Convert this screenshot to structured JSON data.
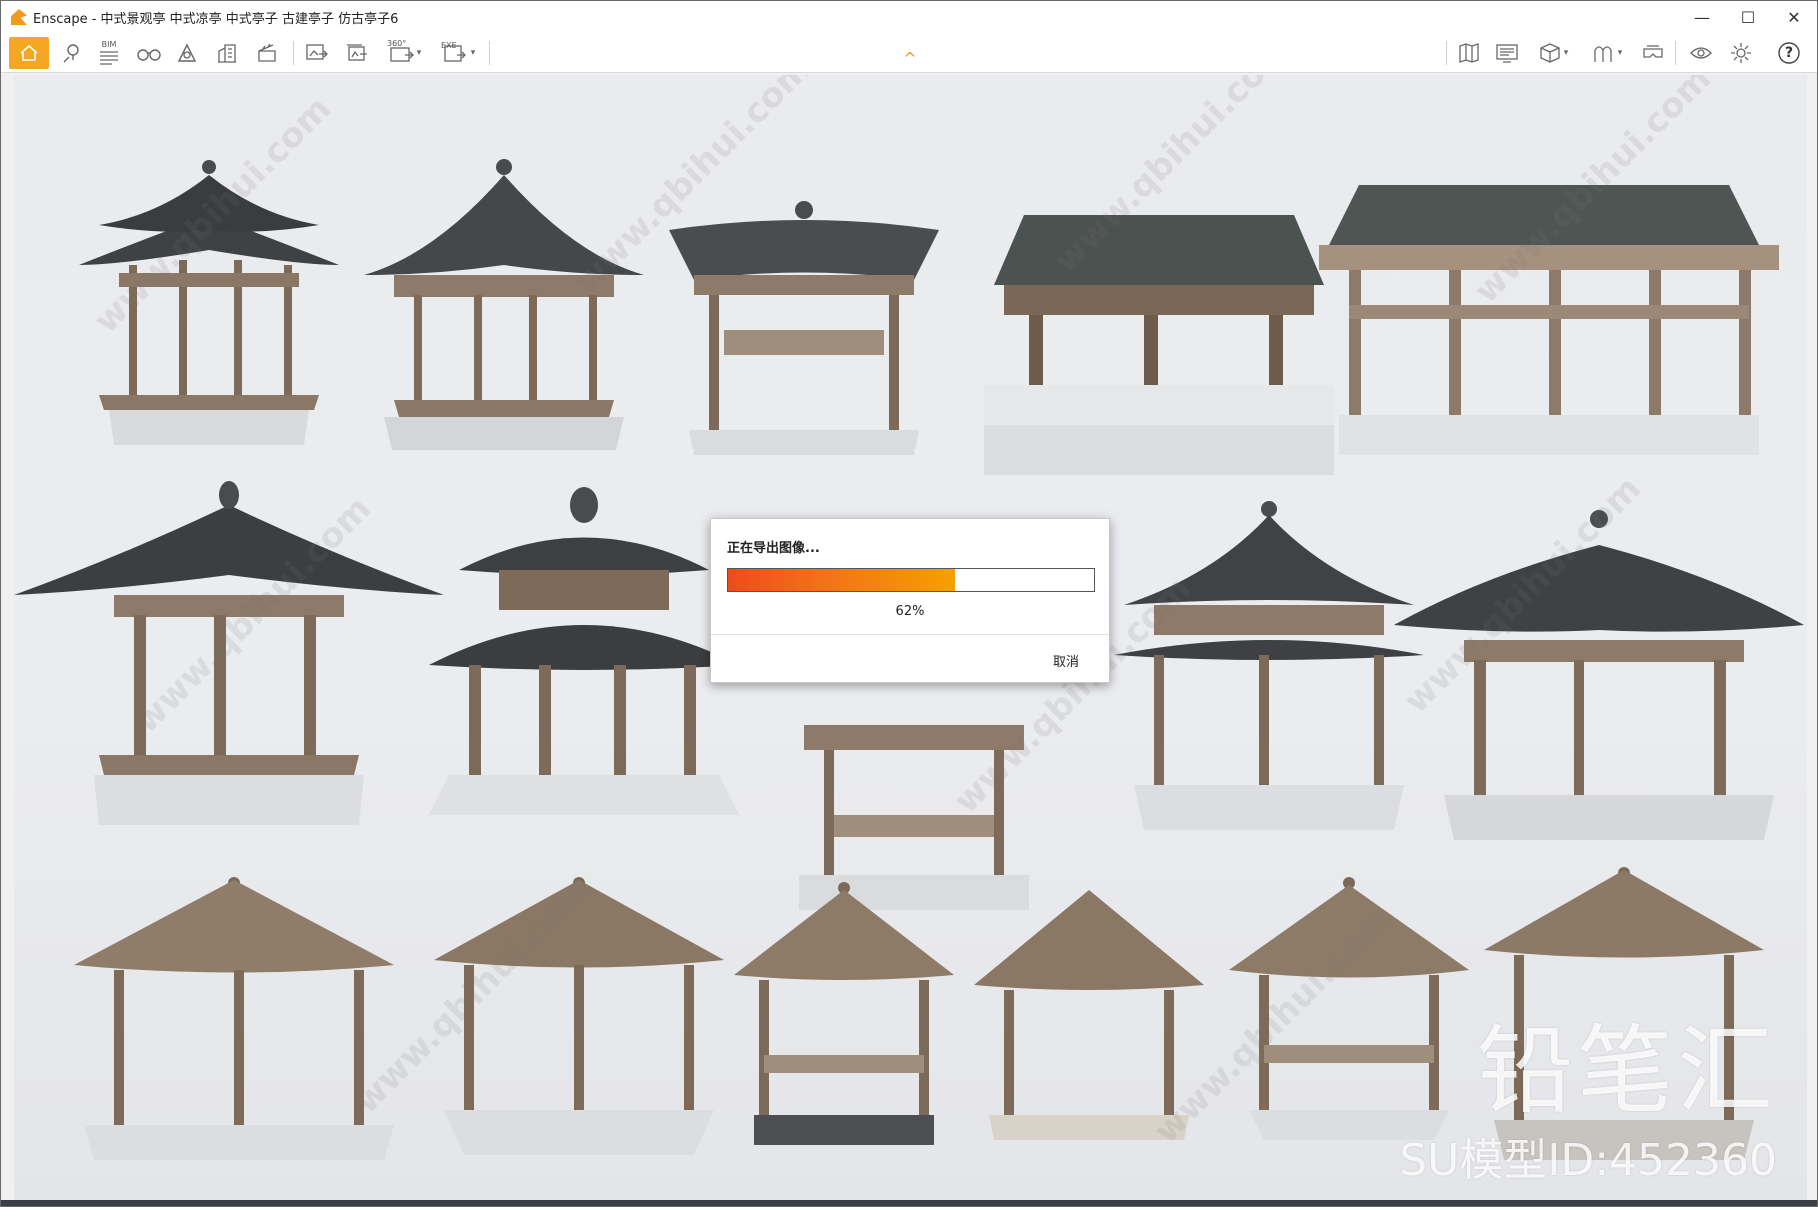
{
  "window": {
    "title": "Enscape - 中式景观亭 中式凉亭 中式亭子 古建亭子 仿古亭子6",
    "controls": {
      "minimize": "—",
      "maximize": "☐",
      "close": "✕"
    }
  },
  "toolbar": {
    "left_icons": [
      "home-icon",
      "location-pin-icon",
      "bim-icon",
      "binoculars-icon",
      "sun-icon",
      "buildings-icon",
      "clapper-icon",
      "screenshot-export-icon",
      "batch-export-icon",
      "panorama-360-icon",
      "exe-export-icon"
    ],
    "bim_label": "BIM",
    "pano_label": "360°",
    "exe_label": "EXE",
    "right_icons": [
      "map-icon",
      "monitor-icon",
      "cube-icon",
      "asset-library-icon",
      "vr-headset-icon",
      "eye-icon",
      "gear-icon",
      "help-icon"
    ],
    "help_label": "?",
    "collapse_glyph": "^",
    "accent": "#f5a623"
  },
  "dialog": {
    "title": "正在导出图像...",
    "progress_percent": 62,
    "progress_label": "62%",
    "cancel_label": "取消"
  },
  "watermark": {
    "brand": "铅笔汇",
    "model_id": "SU模型ID:452360",
    "tile_text": "www.qbihui.com"
  }
}
